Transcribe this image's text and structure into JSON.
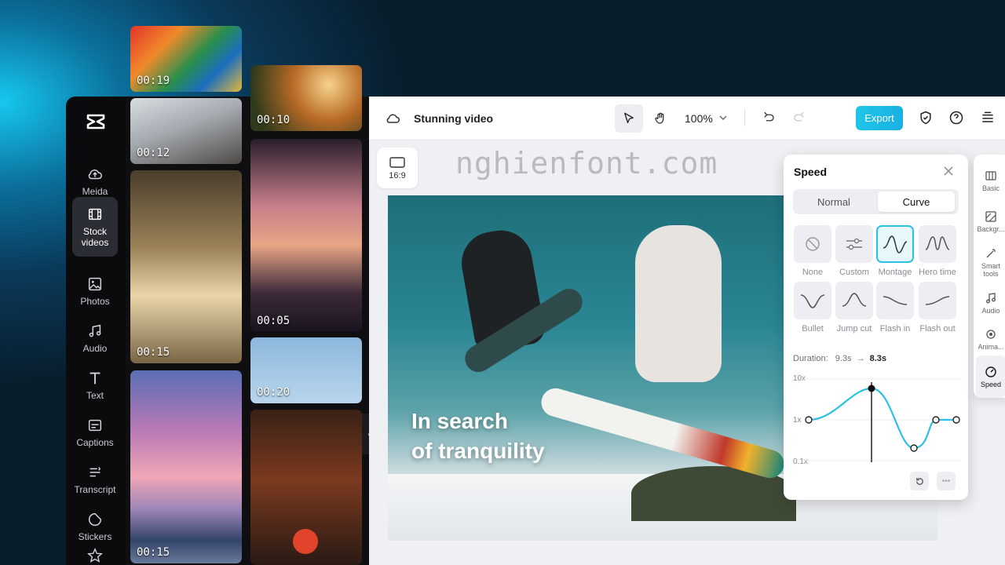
{
  "nav": {
    "items": [
      {
        "label": "Meida",
        "icon": "upload-cloud-icon"
      },
      {
        "label": "Stock\nvideos",
        "icon": "film-icon"
      },
      {
        "label": "Photos",
        "icon": "image-icon"
      },
      {
        "label": "Audio",
        "icon": "music-icon"
      },
      {
        "label": "Text",
        "icon": "text-icon"
      },
      {
        "label": "Captions",
        "icon": "captions-icon"
      },
      {
        "label": "Transcript",
        "icon": "transcript-icon"
      },
      {
        "label": "Stickers",
        "icon": "sticker-icon"
      }
    ]
  },
  "media": {
    "durations": [
      "00:19",
      "00:10",
      "00:12",
      "00:05",
      "00:15",
      "00:20",
      "00:15"
    ]
  },
  "topbar": {
    "project_title": "Stunning video",
    "zoom": "100%",
    "export_label": "Export"
  },
  "canvas": {
    "ratio": "16:9",
    "line1": "In search",
    "line2": "of tranquility",
    "watermark": "nghienfont.com"
  },
  "speed": {
    "title": "Speed",
    "tab_normal": "Normal",
    "tab_curve": "Curve",
    "presets": [
      "None",
      "Custom",
      "Montage",
      "Hero time",
      "Bullet",
      "Jump cut",
      "Flash in",
      "Flash out"
    ],
    "duration_label": "Duration:",
    "duration_from": "9.3s",
    "duration_to": "8.3s",
    "y_max": "10x",
    "y_mid": "1x",
    "y_min": "0.1x"
  },
  "tools": [
    "Basic",
    "Backgr...",
    "Smart\ntools",
    "Audio",
    "Anima...",
    "Speed"
  ],
  "colors": {
    "accent": "#1fc5e8",
    "curve": "#2ec0e4"
  }
}
